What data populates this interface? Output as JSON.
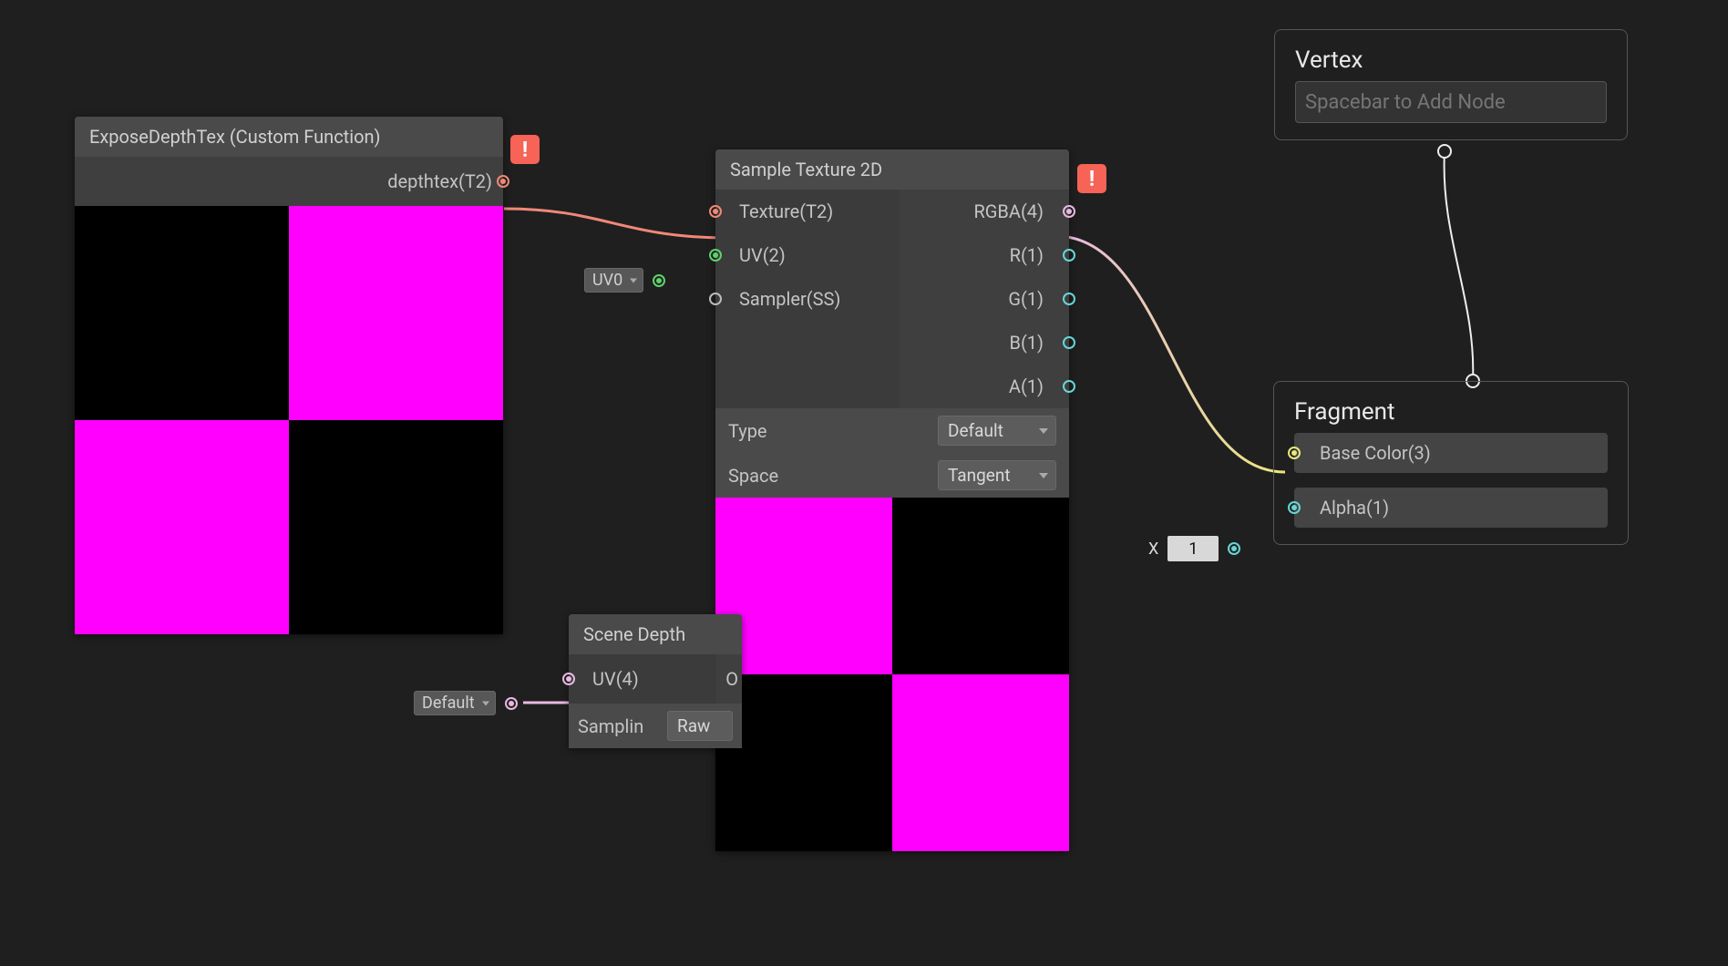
{
  "nodes": {
    "expose": {
      "title": "ExposeDepthTex (Custom Function)",
      "outputs": {
        "depthtex": "depthtex(T2)"
      }
    },
    "sample": {
      "title": "Sample Texture 2D",
      "inputs": {
        "texture": "Texture(T2)",
        "uv": "UV(2)",
        "sampler": "Sampler(SS)",
        "uv_channel": "UV0"
      },
      "outputs": {
        "rgba": "RGBA(4)",
        "r": "R(1)",
        "g": "G(1)",
        "b": "B(1)",
        "a": "A(1)"
      },
      "props": {
        "type_label": "Type",
        "type_value": "Default",
        "space_label": "Space",
        "space_value": "Tangent"
      }
    },
    "scene_depth": {
      "title": "Scene Depth",
      "inputs": {
        "uv": "UV(4)",
        "uv_mode": "Default"
      },
      "outputs": {
        "out": "O"
      },
      "props": {
        "sampling_label": "Samplin",
        "sampling_value": "Raw"
      }
    }
  },
  "masters": {
    "vertex": {
      "title": "Vertex",
      "placeholder": "Spacebar to Add Node"
    },
    "fragment": {
      "title": "Fragment",
      "base_color": "Base Color(3)",
      "alpha": "Alpha(1)",
      "alpha_prefix": "X",
      "alpha_value": "1"
    }
  },
  "colors": {
    "texture_port": "#f08878",
    "uv_port": "#5bd36a",
    "float_port": "#67d6d6",
    "vec4_port": "#e8b8e2",
    "vec3_port": "#e9e77a",
    "generic_port": "#bcbcbc",
    "error": "#f76356"
  }
}
